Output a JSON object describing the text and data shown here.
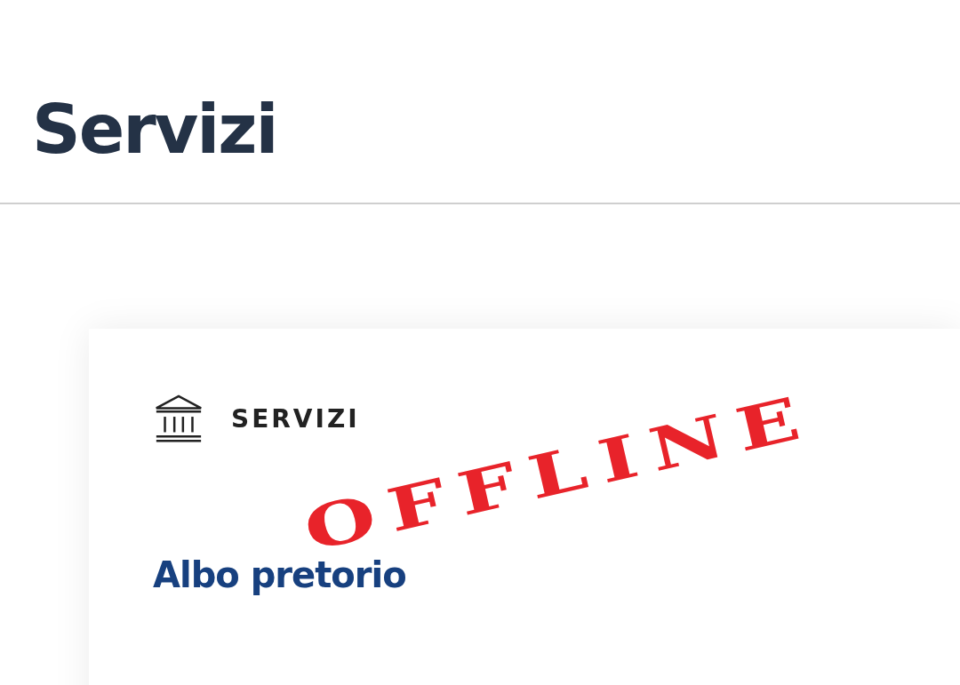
{
  "page": {
    "title": "Servizi"
  },
  "card": {
    "category": "SERVIZI",
    "link": "Albo pretorio"
  },
  "stamp": {
    "text": "OFFLINE"
  }
}
